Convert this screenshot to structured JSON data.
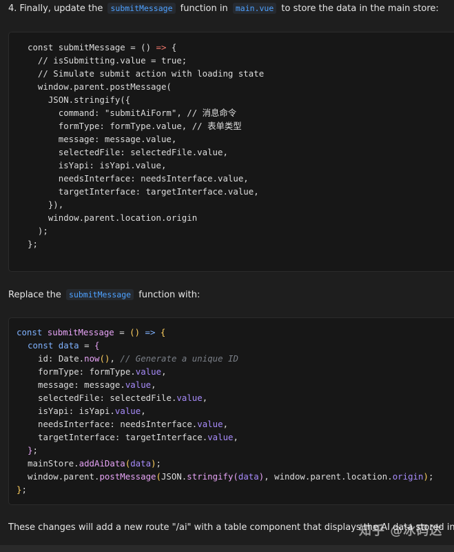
{
  "step_intro": {
    "prefix": "4. Finally, update the",
    "code1": "submitMessage",
    "middle": "function in",
    "code2": "main.vue",
    "suffix": "to store the data in the main store:"
  },
  "block1_lines": [
    "const submitMessage = () ",
    "=>",
    " {",
    "  // isSubmitting.value = true;",
    "  // Simulate submit action with loading state",
    "  window.parent.postMessage(",
    "    JSON.stringify({",
    "      command: \"submitAiForm\", // 消息命令",
    "      formType: formType.value, // 表单类型",
    "      message: message.value,",
    "      selectedFile: selectedFile.value,",
    "      isYapi: isYapi.value,",
    "      needsInterface: needsInterface.value,",
    "      targetInterface: targetInterface.value,",
    "    }),",
    "    window.parent.location.origin",
    "  );",
    "};"
  ],
  "replace": {
    "prefix": "Replace the",
    "code": "submitMessage",
    "suffix": "function with:"
  },
  "block2": {
    "l1": {
      "kw": "const",
      "fn": "submitMessage",
      "eq": " = ",
      "paren": "()",
      "arrow": " => ",
      "brace": "{"
    },
    "l2": {
      "kw": "const",
      "name": "data",
      "eq": " = ",
      "brace": "{"
    },
    "l3": {
      "key": "id: Date.",
      "fn": "now",
      "paren": "()",
      "comma": ", ",
      "comment": "// Generate a unique ID"
    },
    "l4": {
      "key": "formType: formType.",
      "prop": "value",
      "end": ","
    },
    "l5": {
      "key": "message: message.",
      "prop": "value",
      "end": ","
    },
    "l6": {
      "key": "selectedFile: selectedFile.",
      "prop": "value",
      "end": ","
    },
    "l7": {
      "key": "isYapi: isYapi.",
      "prop": "value",
      "end": ","
    },
    "l8": {
      "key": "needsInterface: needsInterface.",
      "prop": "value",
      "end": ","
    },
    "l9": {
      "key": "targetInterface: targetInterface.",
      "prop": "value",
      "end": ","
    },
    "l10": {
      "brace": "}",
      "end": ";"
    },
    "l11": {
      "obj": "mainStore.",
      "fn": "addAiData",
      "open": "(",
      "arg": "data",
      "close": ")",
      "end": ";"
    },
    "l12": {
      "obj": "window.parent.",
      "fn": "postMessage",
      "open": "(",
      "json": "JSON.",
      "fn2": "stringify",
      "open2": "(",
      "arg": "data",
      "close2": ")",
      "mid": ", window.parent.location.",
      "prop": "origin",
      "close": ")",
      "end": ";"
    },
    "l13": {
      "brace": "}",
      "end": ";"
    }
  },
  "closing_text": "These changes will add a new route \"/ai\" with a table component that displays the AI data stored in the main store.",
  "watermark": "知乎 @冰码达"
}
